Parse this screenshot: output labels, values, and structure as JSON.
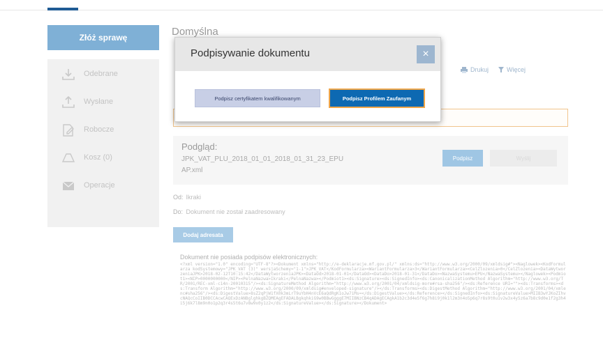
{
  "sidebar": {
    "primary_button": "Złóż sprawę",
    "items": [
      {
        "label": "Odebrane",
        "icon": "download-icon"
      },
      {
        "label": "Wysłane",
        "icon": "upload-icon"
      },
      {
        "label": "Robocze",
        "icon": "draft-icon"
      },
      {
        "label": "Kosz (0)",
        "icon": "trash-icon"
      },
      {
        "label": "Operacje",
        "icon": "mail-icon"
      }
    ]
  },
  "main": {
    "title": "Domyślna",
    "actions": {
      "print": "Drukuj",
      "more": "Więcej"
    },
    "preview": {
      "title": "Podgląd:",
      "filename": "JPK_VAT_PLU_2018_01_01_2018_01_31_23_EPU",
      "extension": "AP.xml",
      "sign_button": "Podpisz",
      "second_button": "Wyślij"
    },
    "from_label": "Od:",
    "from_value": "Ikraki",
    "to_label": "Do:",
    "to_value": "Dokument nie został zaadresowany",
    "send_button": "Dodaj adresata",
    "document_label": "Dokument nie posiada podpisów elektronicznych:",
    "code": "<?xml version=\"1.0\" encoding=\"UTF-8\"?><Dokument xmlns=\"http://e-deklaracje.mf.gov.pl/\" xmlns:ds=\"http://www.w3.org/2000/09/xmldsig#\"><Naglowek><KodFormularza kodSystemowy=\"JPK_VAT (3)\" wersjaSchemy=\"1-1\">JPK_VAT</KodFormularza><WariantFormularza>3</WariantFormularza><CelZlozenia>0</CelZlozenia><DataWytworzeniaJPK>2018-02-12T10:15:42</DataWytworzeniaJPK><DataOd>2018-01-01</DataOd><DataDo>2018-01-31</DataDo><NazwaSystemu>EPU</NazwaSystemu></Naglowek><Podmiot1><NIP>0000000000</NIP><PelnaNazwa>Ikraki</PelnaNazwa></Podmiot1><ds:Signature><ds:SignedInfo><ds:CanonicalizationMethod Algorithm=\"http://www.w3.org/TR/2001/REC-xml-c14n-20010315\"/><ds:SignatureMethod Algorithm=\"http://www.w3.org/2001/04/xmldsig-more#rsa-sha256\"/><ds:Reference URI=\"\"><ds:Transforms><ds:Transform Algorithm=\"http://www.w3.org/2000/09/xmldsig#enveloped-signature\"/></ds:Transforms><ds:DigestMethod Algorithm=\"http://www.w3.org/2001/04/xmlenc#sha256\"/><ds:DigestValue>8sZ2qPjW1fX0k3mLrT9uYbH4nVcE6aQdRgK1oJw7iMs=</ds:DigestValue></ds:Reference></ds:SignedInfo><ds:SignatureValue>MIIB3wYJKoZIhvcNAQcCoIIB0DCCAcwCAQExDzANBglghkgBZQMEAgEFADALBgkqhkiG9w0BBwGgggE7MIIBNzCB4qADAgECAgkA1b2c3d4e5f6g7h8i9j0k1l2m3n4o5p6q7r8s9t0u1v2w3x4y5z6a7b8c9d0e1f2g3h4i5j6k7l8m9n0o1p2q3r4s5t6u7v8w9x0y1z2</ds:SignatureValue></ds:Signature></Dokument>"
  },
  "modal": {
    "title": "Podpisywanie dokumentu",
    "close": "×",
    "button_certificate": "Podpisz certyfikatem kwalifikowanym",
    "button_trusted": "Podpisz Profilem Zaufanym"
  },
  "colors": {
    "accent": "#1f5b94",
    "primary_button": "#0d69b2",
    "focus_outline": "#f0a64a"
  }
}
